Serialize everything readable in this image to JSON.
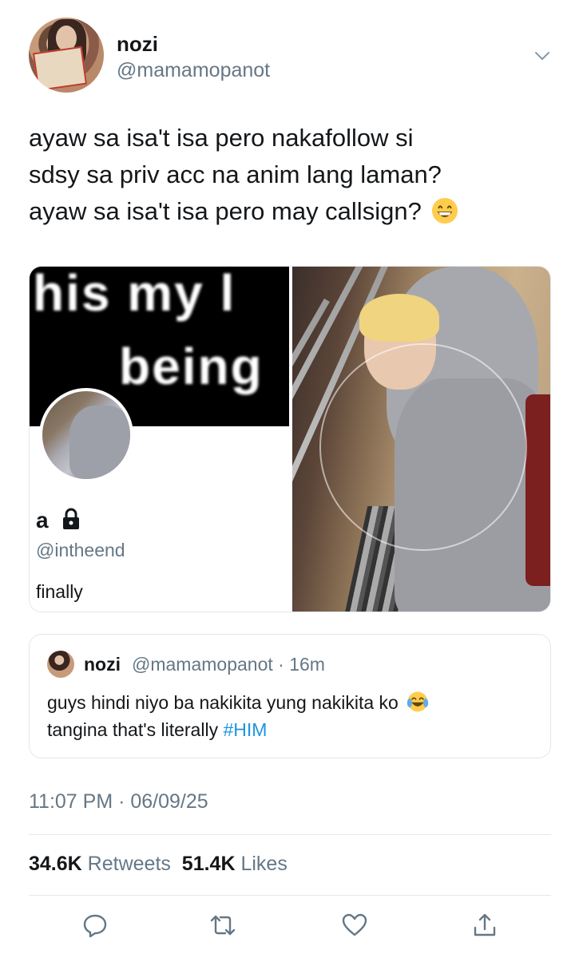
{
  "author": {
    "display_name": "nozi",
    "handle": "@mamamopanot"
  },
  "tweet": {
    "lines": [
      "ayaw sa isa't isa pero nakafollow si",
      "sdsy sa priv acc na anim lang laman?",
      "ayaw sa isa't isa pero may callsign?"
    ],
    "emoji": "grinning-face-emoji"
  },
  "media": {
    "left": {
      "banner_line1": "his my l",
      "banner_line2": "being",
      "profile_name": "a",
      "profile_handle": "@intheend",
      "profile_bio": "finally"
    },
    "right": {
      "description_icon": "photo"
    }
  },
  "quote": {
    "name": "nozi",
    "handle_time": "@mamamopanot · 16m",
    "text_line1": "guys hindi niyo ba nakikita yung nakikita ko",
    "text_line2_prefix": "tangina that's literally ",
    "hashtag": "#HIM",
    "emoji": "face-with-tears-of-joy-emoji"
  },
  "timestamp": "11:07 PM · 06/09/25",
  "stats": {
    "retweets_count": "34.6K",
    "retweets_label": "Retweets",
    "likes_count": "51.4K",
    "likes_label": "Likes"
  },
  "actions": [
    "reply-icon",
    "retweet-icon",
    "like-icon",
    "share-icon"
  ],
  "colors": {
    "text": "#14171a",
    "secondary": "#657786",
    "link": "#1b95e0",
    "border": "#e1e8ed"
  }
}
